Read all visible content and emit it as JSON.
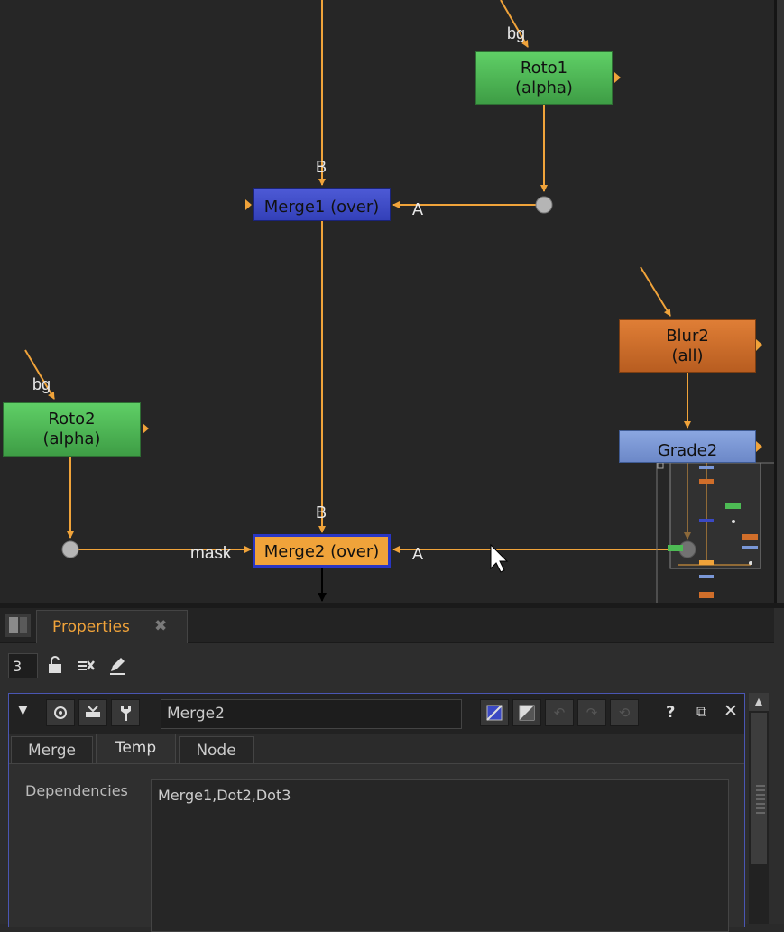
{
  "nodes": {
    "roto1": {
      "line1": "Roto1",
      "line2": "(alpha)",
      "color": "#4dbb54"
    },
    "merge1": {
      "line1": "Merge1 (over)",
      "color": "#3b49c4"
    },
    "blur2": {
      "line1": "Blur2",
      "line2": "(all)",
      "color": "#d06e2a"
    },
    "roto2": {
      "line1": "Roto2",
      "line2": "(alpha)",
      "color": "#4dbb54"
    },
    "grade2": {
      "line1": "Grade2",
      "color": "#7a97d6"
    },
    "merge2": {
      "line1": "Merge2 (over)",
      "color": "#f0a33a"
    }
  },
  "input_labels": {
    "roto1_bg": "bg",
    "roto2_bg": "bg",
    "merge1_b": "B",
    "merge1_a": "A",
    "merge2_b": "B",
    "merge2_a": "A",
    "merge2_mask": "mask"
  },
  "edge_color": "#f0a33a",
  "properties": {
    "tab_label": "Properties",
    "max_panels": "3",
    "node_name": "Merge2",
    "tabs": [
      "Merge",
      "Temp",
      "Node"
    ],
    "active_tab": "Temp",
    "dependencies_label": "Dependencies",
    "dependencies_value": "Merge1,Dot2,Dot3"
  }
}
